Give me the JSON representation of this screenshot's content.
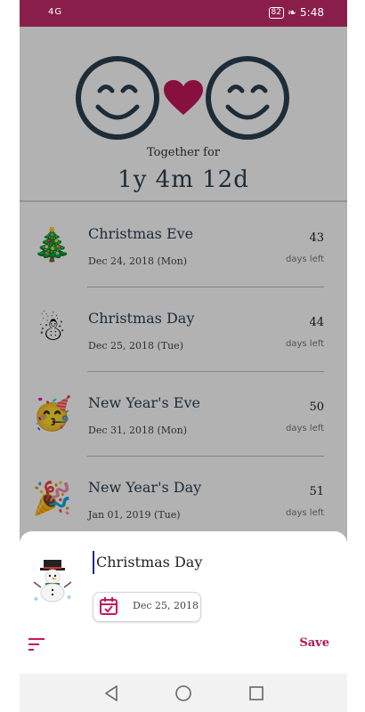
{
  "status_bar": {
    "network": "4G",
    "battery": "82",
    "time": "5:48"
  },
  "header": {
    "together_label": "Together for",
    "together_value": "1y 4m 12d"
  },
  "events": [
    {
      "emoji": "🎄",
      "name": "Christmas Eve",
      "date": "Dec 24, 2018 (Mon)",
      "days": "43",
      "days_label": "days left"
    },
    {
      "emoji": "☃",
      "name": "Christmas Day",
      "date": "Dec 25, 2018 (Tue)",
      "days": "44",
      "days_label": "days left"
    },
    {
      "emoji": "🥳",
      "name": "New Year's Eve",
      "date": "Dec 31, 2018 (Mon)",
      "days": "50",
      "days_label": "days left"
    },
    {
      "emoji": "🎉",
      "name": "New Year's Day",
      "date": "Jan 01, 2019 (Tue)",
      "days": "51",
      "days_label": "days left"
    }
  ],
  "sheet": {
    "emoji": "snowman",
    "event_name": "Christmas Day",
    "date": "Dec 25, 2018",
    "save_label": "Save",
    "accent_color": "#b0174e"
  },
  "colors": {
    "status_bar": "#8a1e4b",
    "face": "#2b3f4f",
    "heart": "#c2185b"
  }
}
